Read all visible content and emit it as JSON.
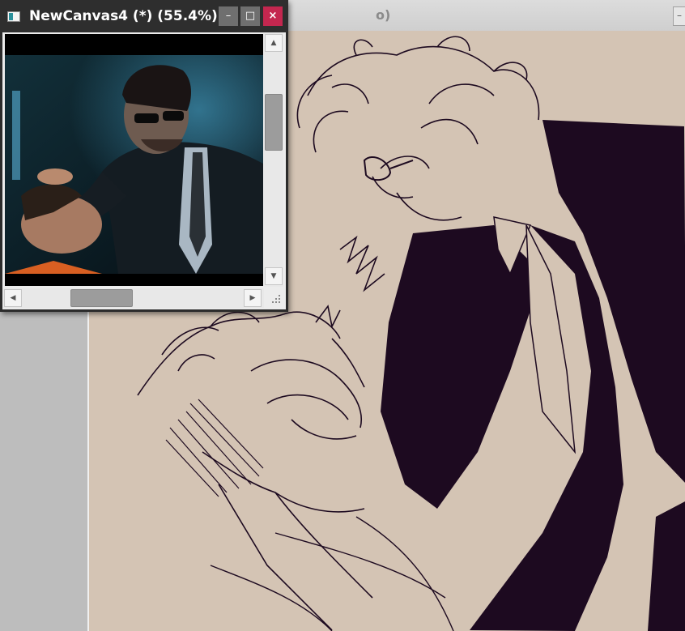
{
  "background_window": {
    "title_fragment": "o)",
    "min_glyph": "–"
  },
  "sub_window": {
    "title": "NewCanvas4 (*) (55.4%)",
    "buttons": {
      "minimize": "–",
      "maximize": "□",
      "close": "×"
    },
    "colors": {
      "titlebar": "#2e2e2e",
      "close": "#c4274f",
      "button": "#6f6f6f"
    }
  },
  "scrollbars": {
    "up_arrow": "▲",
    "down_arrow": "▼",
    "left_arrow": "◀",
    "right_arrow": "▶"
  },
  "canvas": {
    "paper_color": "#d4c4b4",
    "ink_color": "#1d0a20"
  }
}
